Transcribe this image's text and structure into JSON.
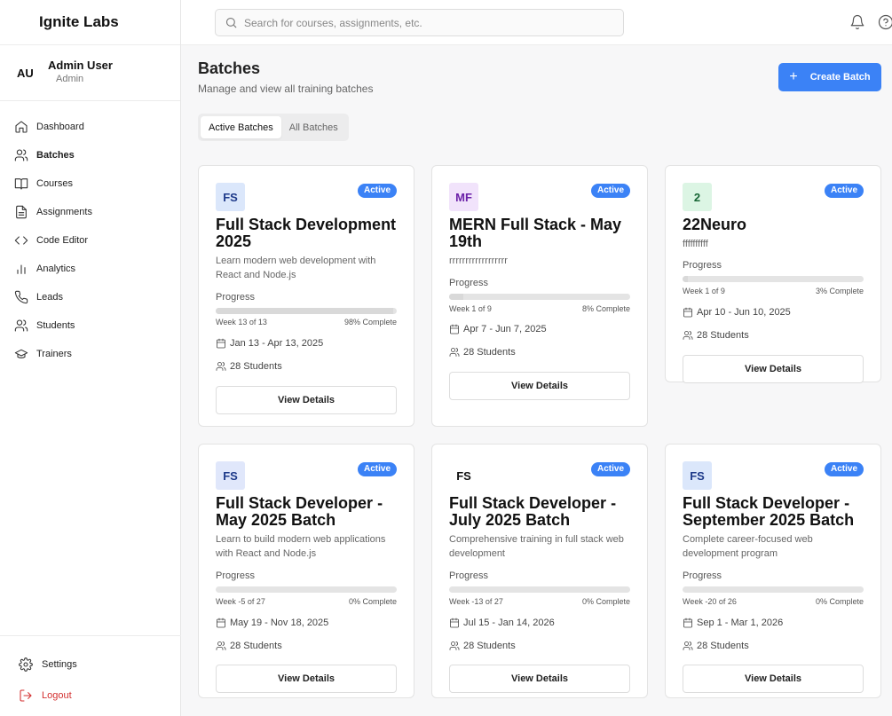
{
  "app": {
    "brand": "Ignite Labs"
  },
  "user": {
    "initials": "AU",
    "name": "Admin User",
    "role": "Admin"
  },
  "sidebar": {
    "items": [
      {
        "label": "Dashboard",
        "icon": "home-icon"
      },
      {
        "label": "Batches",
        "icon": "users-icon"
      },
      {
        "label": "Courses",
        "icon": "book-icon"
      },
      {
        "label": "Assignments",
        "icon": "file-icon"
      },
      {
        "label": "Code Editor",
        "icon": "code-icon"
      },
      {
        "label": "Analytics",
        "icon": "bar-chart-icon"
      },
      {
        "label": "Leads",
        "icon": "phone-icon"
      },
      {
        "label": "Students",
        "icon": "users-icon"
      },
      {
        "label": "Trainers",
        "icon": "graduation-cap-icon"
      }
    ],
    "settings_label": "Settings",
    "logout_label": "Logout"
  },
  "search": {
    "placeholder": "Search for courses, assignments, etc."
  },
  "page": {
    "title": "Batches",
    "subtitle": "Manage and view all training batches",
    "create_label": "Create Batch",
    "tabs": [
      "Active Batches",
      "All Batches"
    ]
  },
  "colors": {
    "accent": "#3b82f6",
    "logout": "#d32f2f"
  },
  "labels": {
    "progress": "Progress",
    "view_details": "View Details"
  },
  "batches": [
    {
      "abbr": "FS",
      "status": "Active",
      "title": "Full Stack Development 2025",
      "desc": "Learn modern web development with React and Node.js",
      "week": "Week 13 of 13",
      "pct_text": "98% Complete",
      "progress": 0.98,
      "dates": "Jan 13 - Apr 13, 2025",
      "students": "28 Students",
      "icon_bg": "#dbe7fb",
      "icon_fg": "#1e3a8a"
    },
    {
      "abbr": "MF",
      "status": "Active",
      "title": "MERN Full Stack - May 19th",
      "desc": "rrrrrrrrrrrrrrrrrr",
      "week": "Week 1 of 9",
      "pct_text": "8% Complete",
      "progress": 0.08,
      "dates": "Apr 7 - Jun 7, 2025",
      "students": "28 Students",
      "icon_bg": "#f1e3fb",
      "icon_fg": "#6b21a8"
    },
    {
      "abbr": "2",
      "status": "Active",
      "title": "22Neuro",
      "desc": "ffffffffff",
      "week": "Week 1 of 9",
      "pct_text": "3% Complete",
      "progress": 0.03,
      "dates": "Apr 10 - Jun 10, 2025",
      "students": "28 Students",
      "icon_bg": "#dcf5e4",
      "icon_fg": "#166534"
    },
    {
      "abbr": "FS",
      "status": "Active",
      "title": "Full Stack Developer - May 2025 Batch",
      "desc": "Learn to build modern web applications with React and Node.js",
      "week": "Week -5 of 27",
      "pct_text": "0% Complete",
      "progress": 0,
      "dates": "May 19 - Nov 18, 2025",
      "students": "28 Students",
      "icon_bg": "#e0e7fb",
      "icon_fg": "#1e3a8a"
    },
    {
      "abbr": "FS",
      "status": "Active",
      "title": "Full Stack Developer - July 2025 Batch",
      "desc": "Comprehensive training in full stack web development",
      "week": "Week -13 of 27",
      "pct_text": "0% Complete",
      "progress": 0,
      "dates": "Jul 15 - Jan 14, 2026",
      "students": "28 Students",
      "icon_bg": "#ffffff",
      "icon_fg": "#111111"
    },
    {
      "abbr": "FS",
      "status": "Active",
      "title": "Full Stack Developer - September 2025 Batch",
      "desc": "Complete career-focused web development program",
      "week": "Week -20 of 26",
      "pct_text": "0% Complete",
      "progress": 0,
      "dates": "Sep 1 - Mar 1, 2026",
      "students": "28 Students",
      "icon_bg": "#dbe7fb",
      "icon_fg": "#1e3a8a"
    }
  ]
}
